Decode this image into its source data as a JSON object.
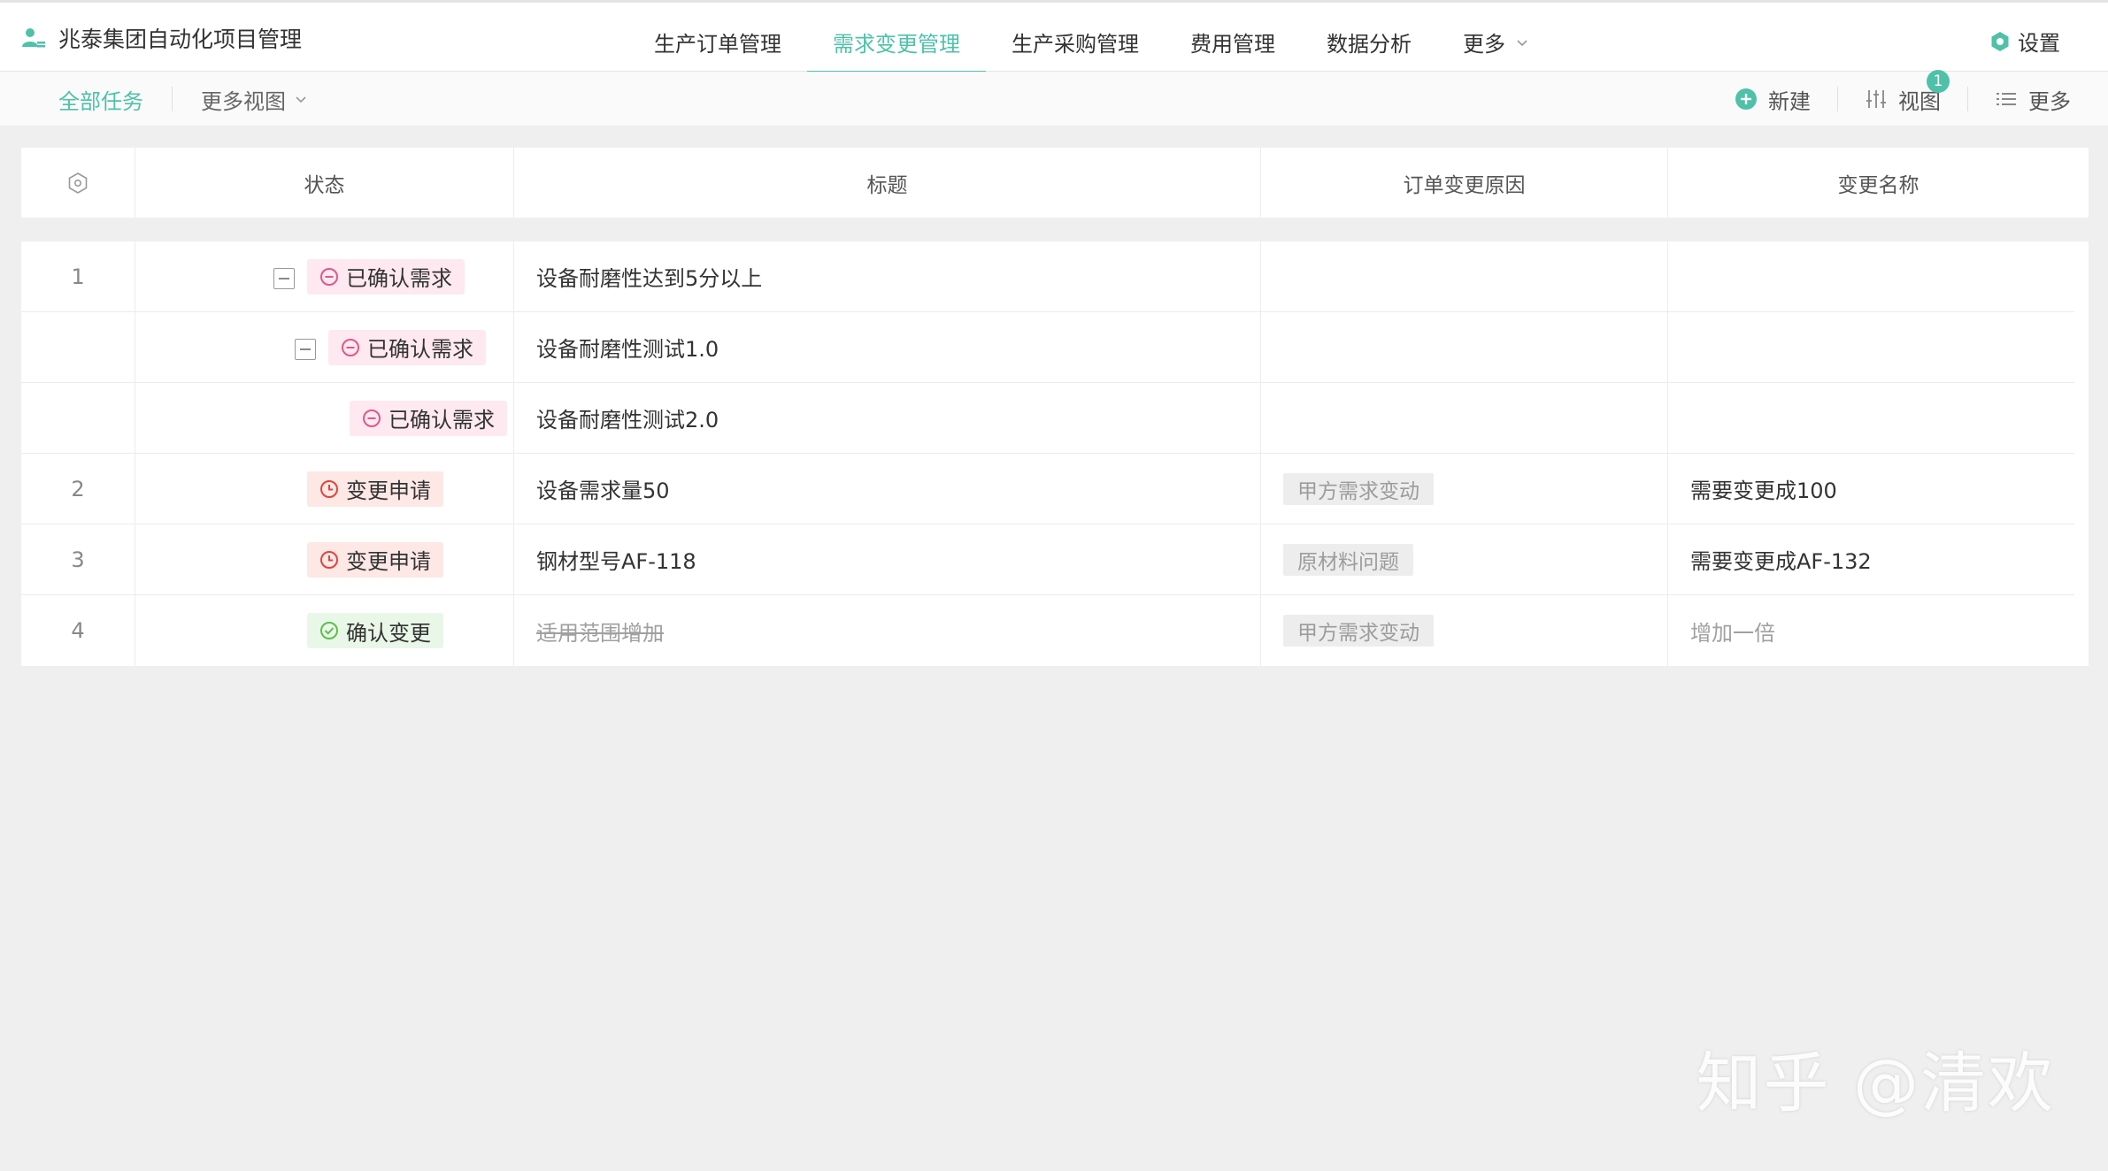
{
  "header": {
    "brand": "兆泰集团自动化项目管理",
    "nav": [
      {
        "label": "生产订单管理"
      },
      {
        "label": "需求变更管理"
      },
      {
        "label": "生产采购管理"
      },
      {
        "label": "费用管理"
      },
      {
        "label": "数据分析"
      },
      {
        "label": "更多"
      }
    ],
    "settings": "设置"
  },
  "toolbar": {
    "tab_all": "全部任务",
    "tab_more_views": "更多视图",
    "new_label": "新建",
    "view_label": "视图",
    "view_badge": "1",
    "more_label": "更多"
  },
  "table": {
    "columns": [
      "状态",
      "标题",
      "订单变更原因",
      "变更名称"
    ],
    "rows": [
      {
        "index": "1",
        "status": "已确认需求",
        "title": "设备耐磨性达到5分以上",
        "reason": "",
        "change": ""
      },
      {
        "index": "",
        "status": "已确认需求",
        "title": "设备耐磨性测试1.0",
        "reason": "",
        "change": ""
      },
      {
        "index": "",
        "status": "已确认需求",
        "title": "设备耐磨性测试2.0",
        "reason": "",
        "change": ""
      },
      {
        "index": "2",
        "status": "变更申请",
        "title": "设备需求量50",
        "reason": "甲方需求变动",
        "change": "需要变更成100"
      },
      {
        "index": "3",
        "status": "变更申请",
        "title": "钢材型号AF-118",
        "reason": "原材料问题",
        "change": "需要变更成AF-132"
      },
      {
        "index": "4",
        "status": "确认变更",
        "title": "适用范围增加",
        "reason": "甲方需求变动",
        "change": "增加一倍"
      }
    ]
  },
  "watermark": "知乎 @清欢",
  "colors": {
    "accent": "#4fc1a9",
    "pink": "#e0578a",
    "red": "#e0453b",
    "green": "#5cbf4d"
  }
}
